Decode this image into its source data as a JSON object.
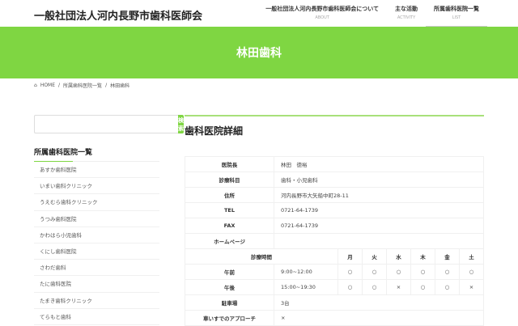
{
  "site_title": "一般社団法人河内長野市歯科医師会",
  "nav": [
    {
      "label": "一般社団法人河内長野市歯科医師会について",
      "sub": "ABOUT"
    },
    {
      "label": "主な活動",
      "sub": "ACTIVITY"
    },
    {
      "label": "所属歯科医院一覧",
      "sub": "LIST"
    }
  ],
  "hero_title": "林田歯科",
  "breadcrumb": [
    "HOME",
    "所属歯科医院一覧",
    "林田歯科"
  ],
  "search": {
    "button": "検索",
    "value": ""
  },
  "sidebar": {
    "title": "所属歯科医院一覧",
    "items": [
      "あすか歯科医院",
      "いまい歯科クリニック",
      "うえむら歯科クリニック",
      "うつみ歯科医院",
      "かわはら小児歯科",
      "くにし歯科医院",
      "さわだ歯科",
      "たに歯科医院",
      "たまき歯科クリニック",
      "てらもと歯科"
    ]
  },
  "main": {
    "title": "歯科医院詳細",
    "info": [
      {
        "label": "医院長",
        "value": "林田　徳裕"
      },
      {
        "label": "診療科目",
        "value": "歯科・小児歯科"
      },
      {
        "label": "住所",
        "value": "河内長野市大矢船中町28-11"
      },
      {
        "label": "TEL",
        "value": "0721-64-1739"
      },
      {
        "label": "FAX",
        "value": "0721-64-1739"
      },
      {
        "label": "ホームページ",
        "value": ""
      }
    ],
    "schedule": {
      "header": "診療時間",
      "days": [
        "月",
        "火",
        "水",
        "木",
        "金",
        "土"
      ],
      "rows": [
        {
          "label": "午前",
          "time": "9:00~12:00",
          "marks": [
            "○",
            "○",
            "○",
            "○",
            "○",
            "○"
          ]
        },
        {
          "label": "午後",
          "time": "15:00~19:30",
          "marks": [
            "○",
            "○",
            "×",
            "○",
            "○",
            "×"
          ]
        }
      ]
    },
    "extra": [
      {
        "label": "駐車場",
        "value": "3台"
      },
      {
        "label": "車いすでのアプローチ",
        "value": "×"
      }
    ]
  }
}
